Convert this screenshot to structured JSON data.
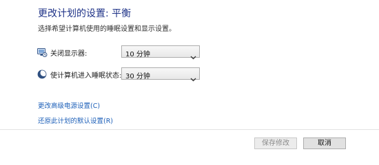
{
  "header": {
    "title": "更改计划的设置: 平衡",
    "subtitle": "选择希望计算机使用的睡眠设置和显示设置。"
  },
  "settings": [
    {
      "icon": "monitor-icon",
      "label": "关闭显示器:",
      "value": "10 分钟"
    },
    {
      "icon": "moon-icon",
      "label": "使计算机进入睡眠状态:",
      "value": "30 分钟"
    }
  ],
  "links": {
    "advanced": "更改高级电源设置(C)",
    "restore": "还原此计划的默认设置(R)"
  },
  "buttons": {
    "save": "保存修改",
    "cancel": "取消"
  },
  "colors": {
    "title": "#1e3287",
    "link": "#1c5fb8"
  }
}
